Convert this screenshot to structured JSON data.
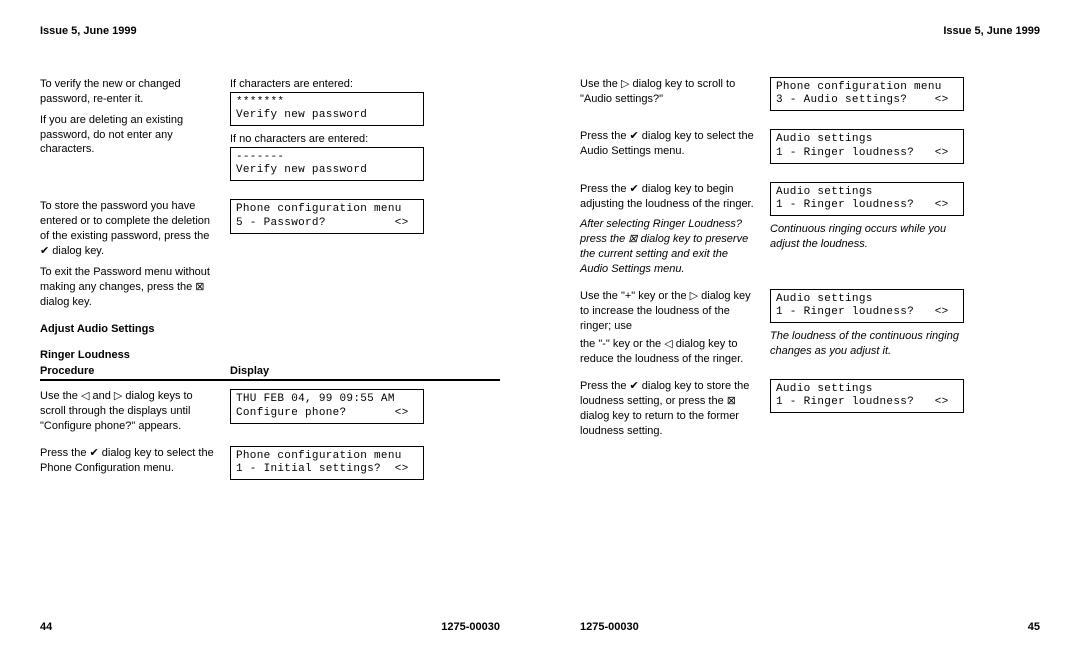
{
  "left": {
    "header": "Issue 5, June 1999",
    "r1_proc_a": "To verify the new or changed password, re-enter it.",
    "r1_proc_b": "If you are deleting an existing password, do not enter any characters.",
    "r1_disp_lbl1": "If characters are entered:",
    "r1_lcd1": "*******\nVerify new password",
    "r1_disp_lbl2": "If no characters are entered:",
    "r1_lcd2": "-------\nVerify new password",
    "r2_proc_a": "To store the password you have entered or to complete the deletion of the existing password, press the ✔ dialog key.",
    "r2_proc_b": "To exit the Password menu without making any changes, press the ⊠ dialog key.",
    "r2_lcd": "Phone configuration menu\n5 - Password?          <>",
    "sect1": "Adjust Audio Settings",
    "sect2": "Ringer Loudness",
    "col_proc": "Procedure",
    "col_disp": "Display",
    "r3_proc": "Use the ◁ and ▷ dialog keys to scroll through the displays until \"Configure phone?\" appears.",
    "r3_lcd": "THU FEB 04, 99 09:55 AM\nConfigure phone?       <>",
    "r4_proc": "Press the ✔ dialog key to select the Phone Configuration menu.",
    "r4_lcd": "Phone configuration menu\n1 - Initial settings?  <>",
    "page_num": "44",
    "doc_id": "1275-00030"
  },
  "right": {
    "header": "Issue 5, June 1999",
    "r1_proc": "Use the ▷ dialog key to scroll to \"Audio settings?\"",
    "r1_lcd": "Phone configuration menu\n3 - Audio settings?    <>",
    "r2_proc": "Press the ✔ dialog key to select the Audio Settings menu.",
    "r2_lcd": "Audio settings\n1 - Ringer loudness?   <>",
    "r3_proc": "Press the ✔ dialog key to begin adjusting the loudness of the ringer.",
    "r3_note": "After selecting Ringer Loudness? press the ⊠ dialog key to preserve the current setting and exit the Audio Settings menu.",
    "r3_lcd": "Audio settings\n1 - Ringer loudness?   <>",
    "r3_disp_note": "Continuous ringing occurs while you adjust the loudness.",
    "r4_proc_a": "Use the \"+\" key or the ▷ dialog key to increase the loudness of the ringer; use",
    "r4_proc_b": "the \"-\" key or the ◁ dialog key to reduce the loudness of the ringer.",
    "r4_lcd": "Audio settings\n1 - Ringer loudness?   <>",
    "r4_disp_note": "The loudness of the continuous ringing changes as you adjust it.",
    "r5_proc": "Press the ✔ dialog key to store the loudness setting, or press the ⊠ dialog key to return to the former loudness setting.",
    "r5_lcd": "Audio settings\n1 - Ringer loudness?   <>",
    "doc_id": "1275-00030",
    "page_num": "45"
  }
}
